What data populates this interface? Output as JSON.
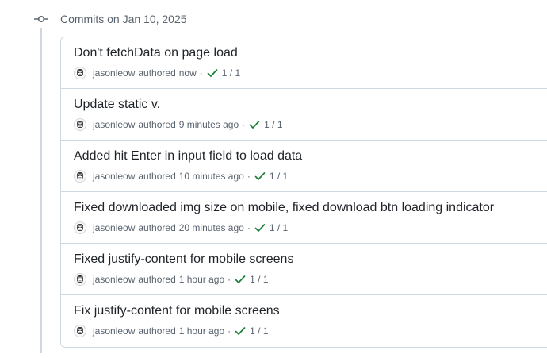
{
  "group": {
    "title": "Commits on Jan 10, 2025",
    "icon": "git-commit-icon"
  },
  "colors": {
    "success": "#1a7f37",
    "muted": "#59636e",
    "border": "#d1d9e0"
  },
  "commits": [
    {
      "title": "Don't fetchData on page load",
      "author": "jasonleow",
      "authored": "authored",
      "time": "now",
      "separator": "·",
      "checks": "1 / 1",
      "status_icon": "check-icon"
    },
    {
      "title": "Update static v.",
      "author": "jasonleow",
      "authored": "authored",
      "time": "9 minutes ago",
      "separator": "·",
      "checks": "1 / 1",
      "status_icon": "check-icon"
    },
    {
      "title": "Added hit Enter in input field to load data",
      "author": "jasonleow",
      "authored": "authored",
      "time": "10 minutes ago",
      "separator": "·",
      "checks": "1 / 1",
      "status_icon": "check-icon"
    },
    {
      "title": "Fixed downloaded img size on mobile, fixed download btn loading indicator",
      "author": "jasonleow",
      "authored": "authored",
      "time": "20 minutes ago",
      "separator": "·",
      "checks": "1 / 1",
      "status_icon": "check-icon"
    },
    {
      "title": "Fixed justify-content for mobile screens",
      "author": "jasonleow",
      "authored": "authored",
      "time": "1 hour ago",
      "separator": "·",
      "checks": "1 / 1",
      "status_icon": "check-icon"
    },
    {
      "title": "Fix justify-content for mobile screens",
      "author": "jasonleow",
      "authored": "authored",
      "time": "1 hour ago",
      "separator": "·",
      "checks": "1 / 1",
      "status_icon": "check-icon"
    }
  ]
}
